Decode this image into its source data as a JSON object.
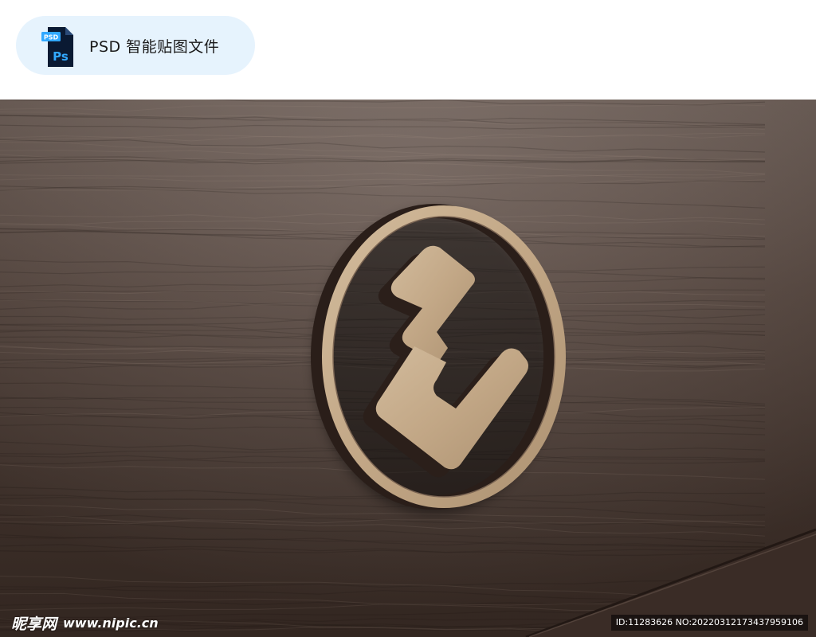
{
  "header": {
    "badge_label": "PSD 智能贴图文件",
    "file_icon": {
      "name": "photoshop-file-icon",
      "tag_text": "PSD",
      "app_text": "Ps",
      "colors": {
        "file_body": "#0a1a33",
        "tag": "#31a8ff",
        "text": "#31a8ff"
      }
    }
  },
  "scene": {
    "background": "dark walnut wood wall",
    "sign": "round wooden logo sign with stylized Z mark",
    "colors": {
      "wood_dark": "#4a3a33",
      "wood_mid": "#5a4840",
      "wood_light_sign": "#c7ae8f",
      "sign_edge": "#8a7560"
    }
  },
  "watermark": {
    "brand": "昵享网",
    "url": "www.nipic.cn",
    "id_text": "ID:11283626 NO:20220312173437959106"
  }
}
